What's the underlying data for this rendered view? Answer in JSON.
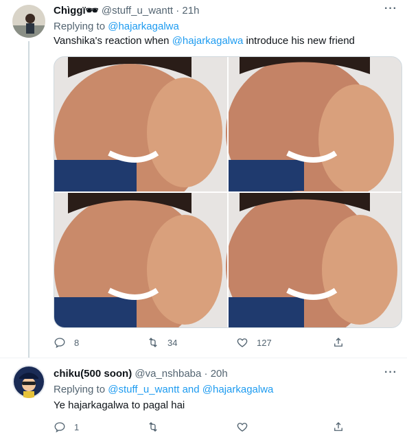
{
  "tweets": [
    {
      "author_name": "Chìggï🕶",
      "handle": "@stuff_u_wantt",
      "separator": "·",
      "time": "21h",
      "replying_prefix": "Replying to",
      "replying_to": "@hajarkagalwa",
      "text_before": "Vanshika's reaction when ",
      "text_mention": "@hajarkagalwa",
      "text_after": " introduce his new friend",
      "replies": "8",
      "retweets": "34",
      "likes": "127"
    },
    {
      "author_name": "chiku(500 soon)",
      "handle": "@va_nshbaba",
      "separator": "·",
      "time": "20h",
      "replying_prefix": "Replying to",
      "replying_to": "@stuff_u_wantt",
      "replying_and": "and",
      "replying_to_2": "@hajarkagalwa",
      "text": "Ye hajarkagalwa to pagal hai",
      "replies": "1",
      "retweets": "",
      "likes": ""
    }
  ],
  "colors": {
    "link": "#1d9bf0",
    "muted": "#536471",
    "text": "#0f1419",
    "thread_line": "#cfd9de"
  },
  "icons": [
    "more-icon",
    "reply-icon",
    "retweet-icon",
    "like-icon",
    "share-icon"
  ]
}
